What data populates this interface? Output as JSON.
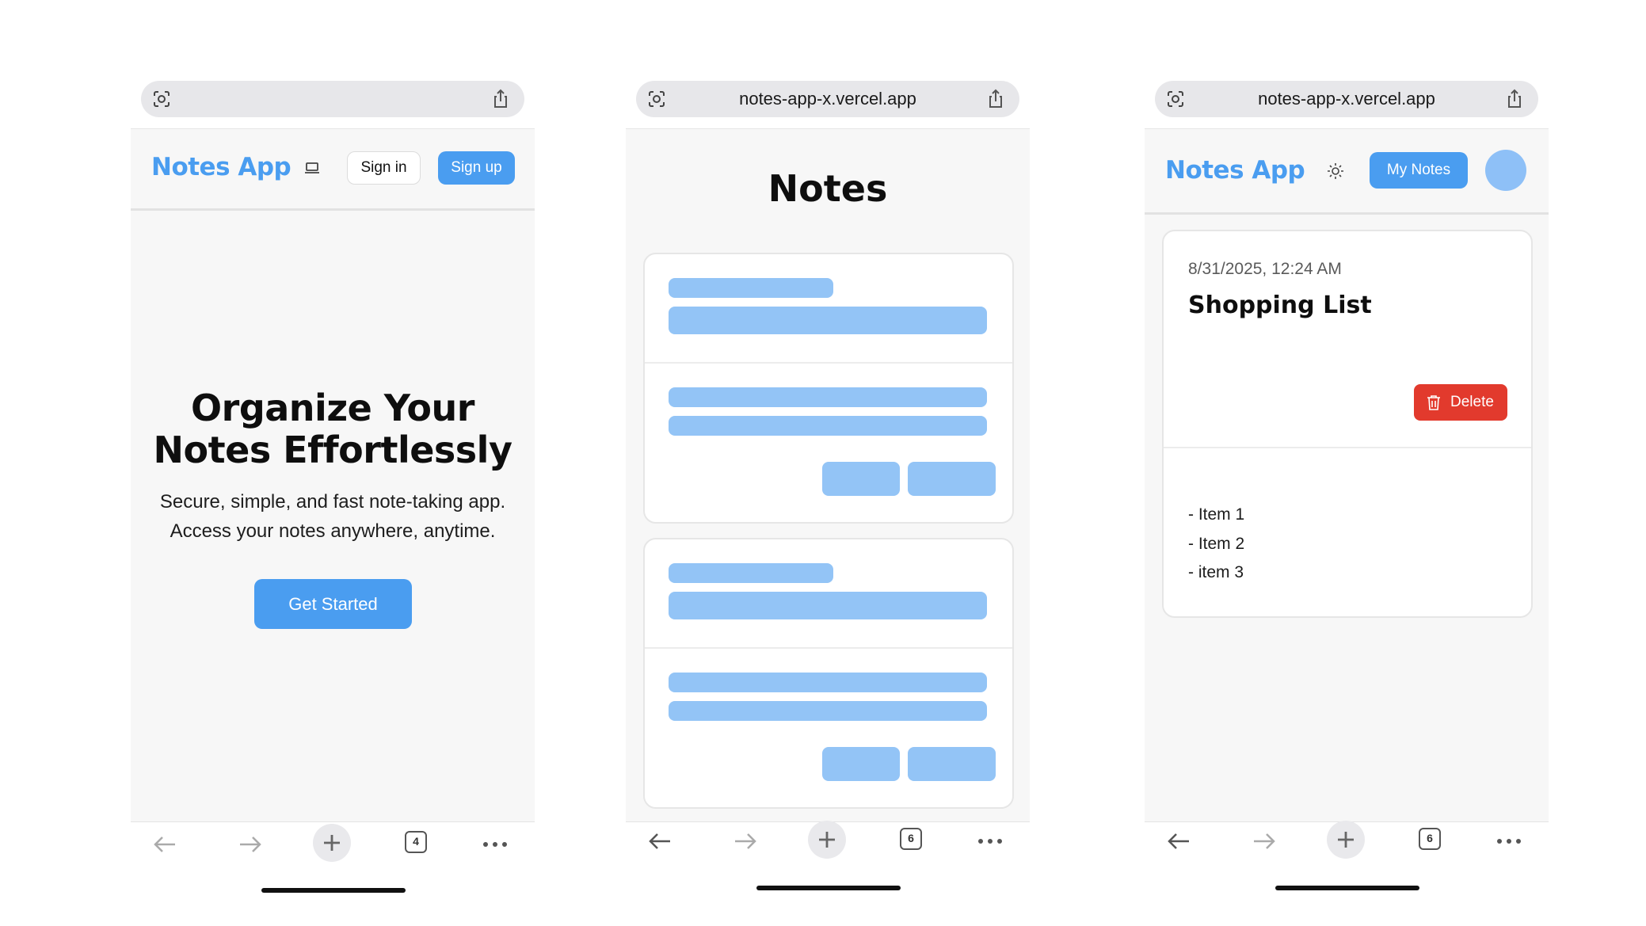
{
  "phone1": {
    "url": "",
    "nav": {
      "brand": "Notes App",
      "signin_label": "Sign in",
      "signup_label": "Sign up"
    },
    "hero": {
      "title_line1": "Organize Your",
      "title_line2": "Notes Effortlessly",
      "subtitle_line1": "Secure, simple, and fast note-taking app.",
      "subtitle_line2": "Access your notes anywhere, anytime.",
      "cta_label": "Get Started"
    },
    "toolbar": {
      "tab_count": "4"
    }
  },
  "phone2": {
    "url": "notes-app-x.vercel.app",
    "page_title": "Notes",
    "toolbar": {
      "tab_count": "6"
    }
  },
  "phone3": {
    "url": "notes-app-x.vercel.app",
    "nav": {
      "brand": "Notes App",
      "my_notes_label": "My Notes"
    },
    "note": {
      "date": "8/31/2025, 12:24 AM",
      "title": "Shopping List",
      "delete_label": "Delete",
      "items": [
        "- Item 1",
        "- Item 2",
        "- item 3"
      ]
    },
    "toolbar": {
      "tab_count": "6"
    }
  },
  "colors": {
    "accent": "#4a9df0",
    "skeleton": "#93c4f6",
    "danger": "#e23a2d",
    "avatar": "#8ec0f7"
  },
  "icons": [
    "visual-lookup-icon",
    "share-icon",
    "laptop-icon",
    "sun-icon",
    "trash-icon",
    "back-arrow-icon",
    "forward-arrow-icon",
    "new-tab-plus-icon",
    "tabs-icon",
    "more-icon"
  ]
}
